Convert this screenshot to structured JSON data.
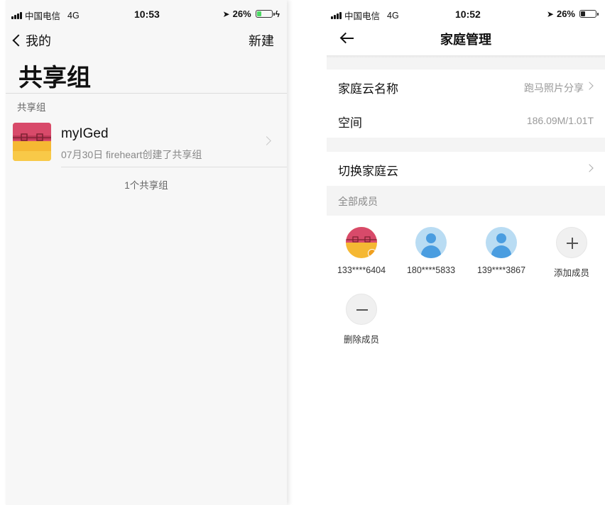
{
  "left": {
    "status": {
      "carrier": "中国电信",
      "network": "4G",
      "time": "10:53",
      "battery": "26%"
    },
    "nav": {
      "back_label": "我的",
      "new_label": "新建"
    },
    "title": "共享组",
    "section_label": "共享组",
    "group": {
      "name": "myIGed",
      "subtitle": "07月30日 fireheart创建了共享组"
    },
    "count": "1个共享组"
  },
  "right": {
    "status": {
      "carrier": "中国电信",
      "network": "4G",
      "time": "10:52",
      "battery": "26%"
    },
    "title": "家庭管理",
    "cloud_name": {
      "label": "家庭云名称",
      "value": "跑马照片分享"
    },
    "space": {
      "label": "空间",
      "value": "186.09M/1.01T"
    },
    "switch_cloud": {
      "label": "切换家庭云"
    },
    "members_label": "全部成员",
    "members": [
      {
        "label": "133****6404"
      },
      {
        "label": "180****5833"
      },
      {
        "label": "139****3867"
      }
    ],
    "add_member": "添加成员",
    "remove_member": "删除成员"
  },
  "colors": {
    "battery_green": "#4cd964",
    "battery_dark": "#222222",
    "avatar_red": "#d84a6a",
    "avatar_yellow": "#f5b833",
    "default_avatar_bg": "#b9dcf3",
    "default_avatar_fg": "#4a9de0"
  },
  "icons": {
    "back_left": "chevron-left-icon",
    "back_right": "arrow-left-icon",
    "add": "plus-icon",
    "remove": "minus-icon"
  }
}
